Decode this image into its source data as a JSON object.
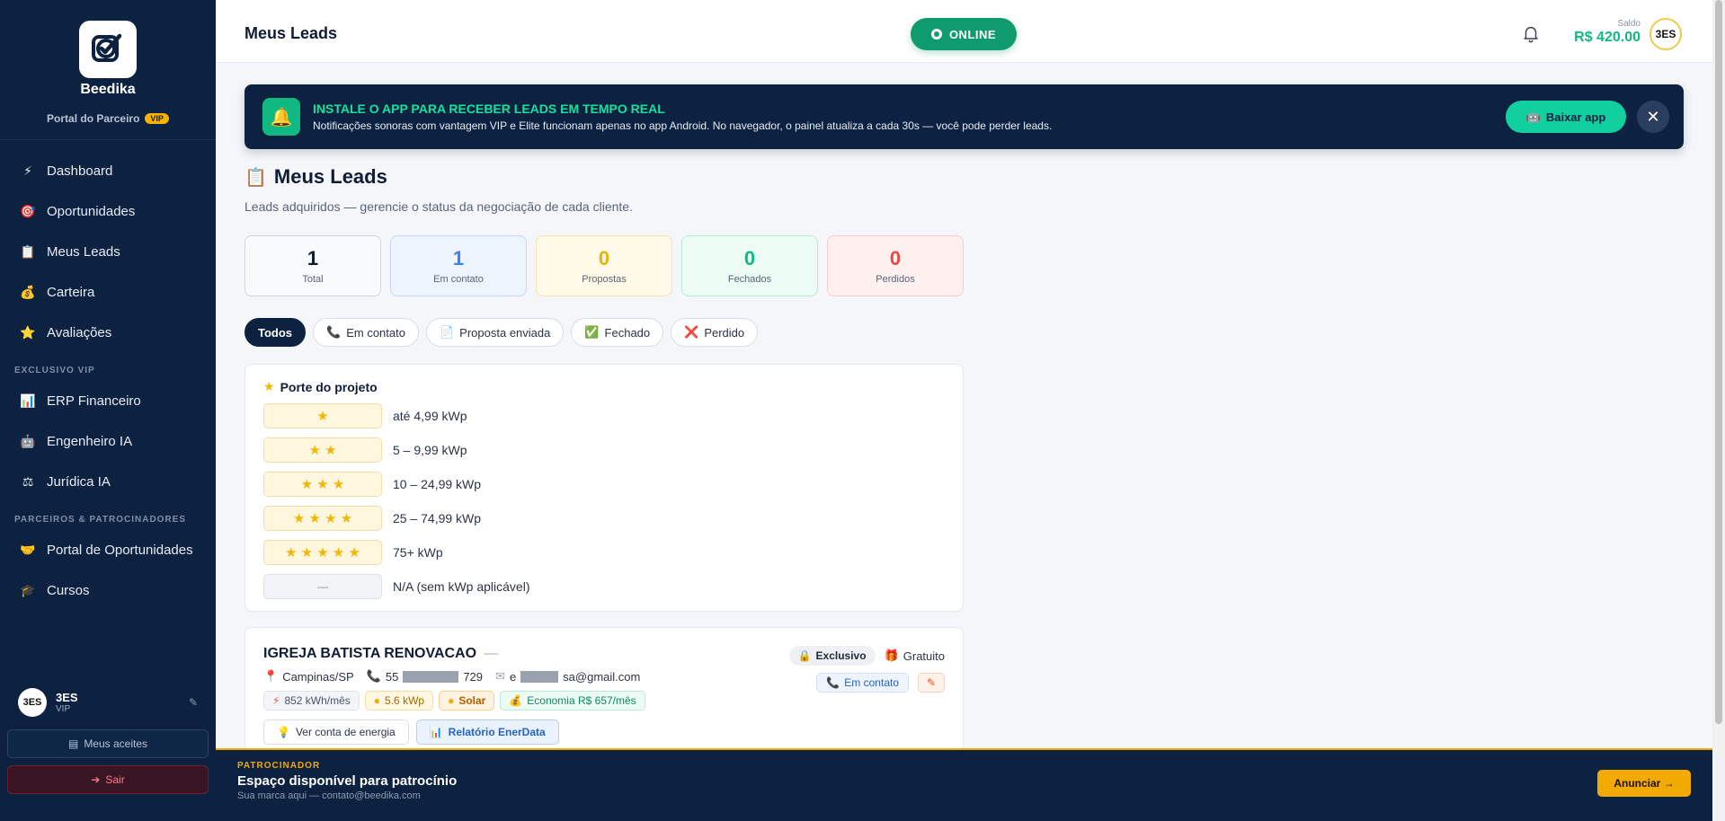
{
  "brand": {
    "name": "Beedika",
    "subtitle": "Portal do Parceiro",
    "vip_badge": "VIP"
  },
  "sidebar": {
    "items": [
      {
        "label": "Dashboard",
        "icon": "⚡",
        "icon_name": "lightning-icon"
      },
      {
        "label": "Oportunidades",
        "icon": "🎯",
        "icon_name": "target-icon"
      },
      {
        "label": "Meus Leads",
        "icon": "📋",
        "icon_name": "clipboard-icon"
      },
      {
        "label": "Carteira",
        "icon": "💰",
        "icon_name": "money-bag-icon"
      },
      {
        "label": "Avaliações",
        "icon": "⭐",
        "icon_name": "star-icon"
      }
    ],
    "section_vip": "Exclusivo VIP",
    "vip_items": [
      {
        "label": "ERP Financeiro",
        "icon": "📊",
        "icon_name": "chart-icon"
      },
      {
        "label": "Engenheiro IA",
        "icon": "🤖",
        "icon_name": "robot-icon"
      },
      {
        "label": "Jurídica IA",
        "icon": "⚖",
        "icon_name": "scales-icon"
      }
    ],
    "section_partners": "Parceiros & Patrocinadores",
    "partner_items": [
      {
        "label": "Portal de Oportunidades",
        "icon": "🤝",
        "icon_name": "handshake-icon"
      },
      {
        "label": "Cursos",
        "icon": "🎓",
        "icon_name": "graduation-icon"
      }
    ],
    "user": {
      "name": "3ES",
      "role": "VIP",
      "avatar_text": "3ES"
    },
    "aceites_label": "Meus aceites",
    "sair_label": "Sair"
  },
  "topbar": {
    "title": "Meus Leads",
    "status": "ONLINE",
    "saldo_label": "Saldo",
    "saldo_value": "R$ 420.00",
    "avatar_text": "3ES"
  },
  "install_banner": {
    "title": "INSTALE O APP PARA RECEBER LEADS EM TEMPO REAL",
    "description": "Notificações sonoras com vantagem VIP e Elite funcionam apenas no app Android. No navegador, o painel atualiza a cada 30s — você pode perder leads.",
    "button_label": "Baixar app"
  },
  "page": {
    "title": "Meus Leads",
    "subtitle": "Leads adquiridos — gerencie o status da negociação de cada cliente."
  },
  "stats": [
    {
      "value": "1",
      "label": "Total"
    },
    {
      "value": "1",
      "label": "Em contato"
    },
    {
      "value": "0",
      "label": "Propostas"
    },
    {
      "value": "0",
      "label": "Fechados"
    },
    {
      "value": "0",
      "label": "Perdidos"
    }
  ],
  "filters": [
    {
      "label": "Todos",
      "icon": ""
    },
    {
      "label": "Em contato",
      "icon": "📞"
    },
    {
      "label": "Proposta enviada",
      "icon": "📄"
    },
    {
      "label": "Fechado",
      "icon": "✅"
    },
    {
      "label": "Perdido",
      "icon": "❌"
    }
  ],
  "porte": {
    "title": "Porte do projeto",
    "rows": [
      {
        "stars": 1,
        "label": "até 4,99 kWp"
      },
      {
        "stars": 2,
        "label": "5 – 9,99 kWp"
      },
      {
        "stars": 3,
        "label": "10 – 24,99 kWp"
      },
      {
        "stars": 4,
        "label": "25 – 74,99 kWp"
      },
      {
        "stars": 5,
        "label": "75+ kWp"
      },
      {
        "stars": 0,
        "na_text": "—",
        "label": "N/A (sem kWp aplicável)"
      }
    ]
  },
  "lead": {
    "name": "IGREJA BATISTA RENOVACAO",
    "name_suffix": "—",
    "city": "Campinas/SP",
    "phone_prefix": "55",
    "phone_suffix": "729",
    "email_prefix": "e",
    "email_suffix": "sa@gmail.com",
    "tags": {
      "kwh": "852 kWh/mês",
      "kwp": "5.6 kWp",
      "solar": "Solar",
      "economia": "Economia R$ 657/mês"
    },
    "badge_exclusivo": "Exclusivo",
    "badge_gratuito": "Gratuito",
    "status": "Em contato",
    "actions": {
      "conta": "Ver conta de energia",
      "relatorio": "Relatório EnerData"
    }
  },
  "sponsor": {
    "kicker": "PATROCINADOR",
    "title": "Espaço disponível para patrocínio",
    "subtitle": "Sua marca aqui — contato@beedika.com",
    "button_label": "Anunciar →"
  }
}
